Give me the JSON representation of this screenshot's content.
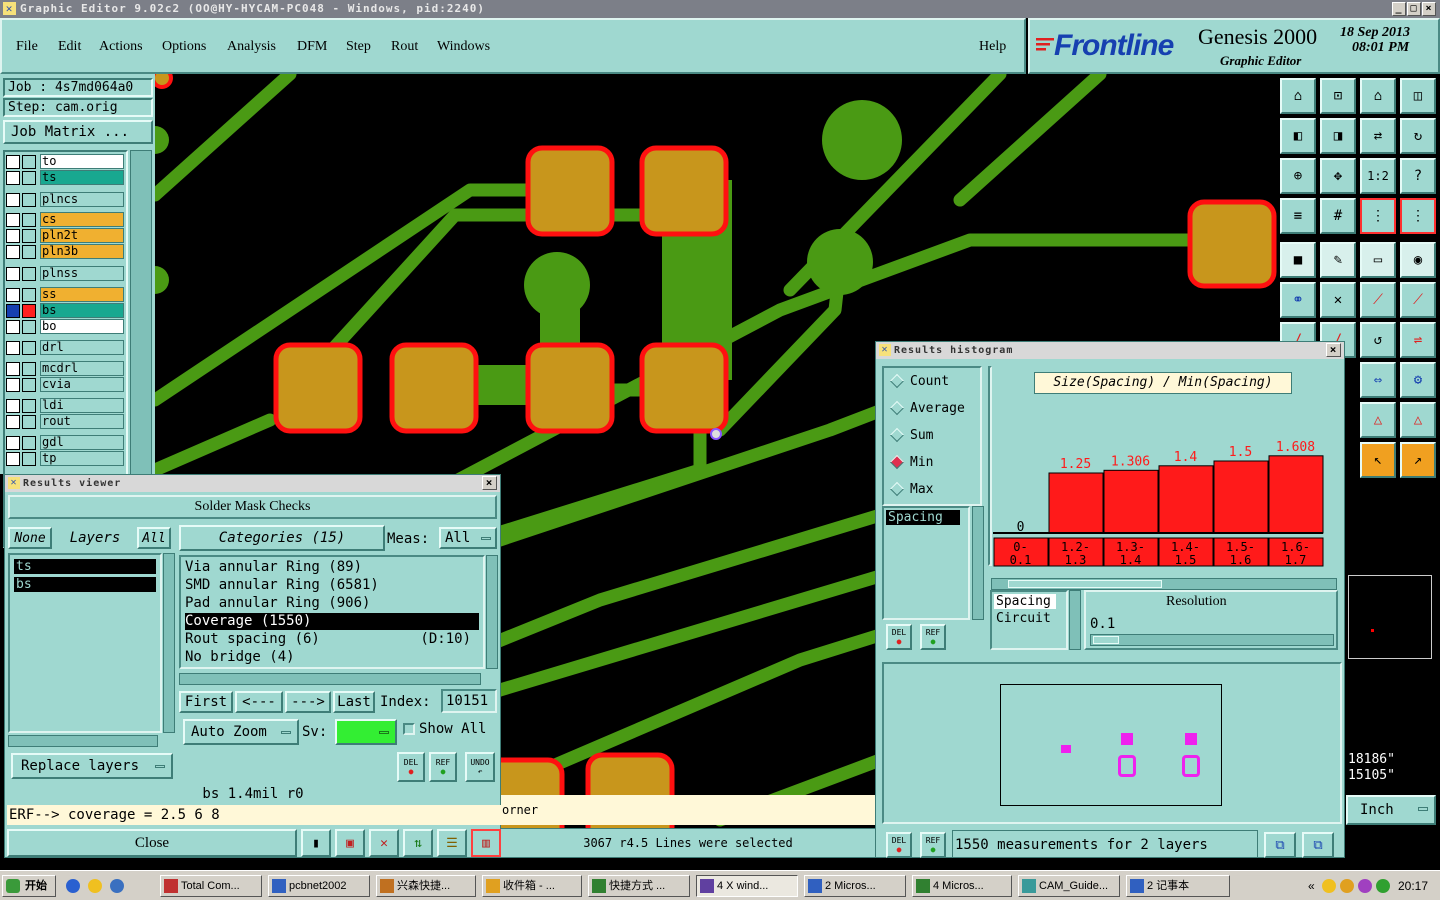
{
  "window": {
    "title": "Graphic Editor 9.02c2 (OO@HY-HYCAM-PC048 - Windows, pid:2240)"
  },
  "menu": {
    "items": [
      "File",
      "Edit",
      "Actions",
      "Options",
      "Analysis",
      "DFM",
      "Step",
      "Rout",
      "Windows"
    ],
    "help": "Help"
  },
  "brand": {
    "logo": "Frontline",
    "product": "Genesis 2000",
    "subtitle": "Graphic Editor",
    "date": "18 Sep 2013",
    "time": "08:01 PM"
  },
  "job": {
    "job_line": "Job : 4s7md064a0",
    "step_line": "Step: cam.orig",
    "matrix_button": "Job Matrix ..."
  },
  "layers": [
    {
      "name": "to",
      "color": "#ffffff"
    },
    {
      "name": "ts",
      "color": "#18a890"
    },
    {
      "name": "plncs",
      "color": "#9fd8d0"
    },
    {
      "name": "cs",
      "color": "#f0b030"
    },
    {
      "name": "pln2t",
      "color": "#f0b030"
    },
    {
      "name": "pln3b",
      "color": "#f0b030"
    },
    {
      "name": "plnss",
      "color": "#9fd8d0"
    },
    {
      "name": "ss",
      "color": "#f0b030"
    },
    {
      "name": "bs",
      "color": "#18a890"
    },
    {
      "name": "bo",
      "color": "#ffffff"
    },
    {
      "name": "drl",
      "color": "#9fd8d0"
    },
    {
      "name": "mcdrl",
      "color": "#9fd8d0"
    },
    {
      "name": "cvia",
      "color": "#9fd8d0"
    },
    {
      "name": "ldi",
      "color": "#9fd8d0"
    },
    {
      "name": "rout",
      "color": "#9fd8d0"
    },
    {
      "name": "gdl",
      "color": "#9fd8d0"
    },
    {
      "name": "tp",
      "color": "#9fd8d0"
    }
  ],
  "results_viewer": {
    "title": "Results viewer",
    "header": "Solder Mask Checks",
    "none_btn": "None",
    "layers_label": "Layers",
    "all_btn": "All",
    "layer_items": [
      "ts",
      "bs"
    ],
    "categories_label": "Categories (15)",
    "meas_label": "Meas:",
    "meas_value": "All",
    "categories": [
      {
        "label": "Via annular Ring (89)",
        "extra": ""
      },
      {
        "label": "SMD annular Ring (6581)",
        "extra": ""
      },
      {
        "label": "Pad annular Ring (906)",
        "extra": ""
      },
      {
        "label": "Coverage (1550)",
        "extra": ""
      },
      {
        "label": "Rout spacing (6)",
        "extra": "(D:10)"
      },
      {
        "label": "No bridge (4)",
        "extra": ""
      }
    ],
    "first_btn": "First",
    "prev_btn": "<---",
    "next_btn": "--->",
    "last_btn": "Last",
    "index_label": "Index:",
    "index_value": "10151",
    "auto_zoom": "Auto Zoom",
    "sv_label": "Sv:",
    "show_all": "Show All",
    "replace_layers": "Replace layers",
    "del": "DEL",
    "ref": "REF",
    "undo": "UNDO",
    "status": "bs 1.4mil   r0",
    "erf": "ERF--> coverage = 2.5 6 8",
    "close": "Close"
  },
  "histogram": {
    "title": "Results histogram",
    "stats": [
      "Count",
      "Average",
      "Sum",
      "Min",
      "Max"
    ],
    "selected_stat": "Min",
    "chart_title": "Size(Spacing) / Min(Spacing)",
    "list_items": [
      "Spacing"
    ],
    "zero_label": "0",
    "chart_data": {
      "type": "bar",
      "title": "Size(Spacing) / Min(Spacing)",
      "categories": [
        "0-0.1",
        "1.2-1.3",
        "1.3-1.4",
        "1.4-1.5",
        "1.5-1.6",
        "1.6-1.7"
      ],
      "values": [
        0,
        1.25,
        1.306,
        1.4,
        1.5,
        1.608
      ],
      "value_labels": [
        "0",
        "1.25",
        "1.306",
        "1.4",
        "1.5",
        "1.608"
      ]
    },
    "bins": [
      [
        "0-",
        "0.1"
      ],
      [
        "1.2-",
        "1.3"
      ],
      [
        "1.3-",
        "1.4"
      ],
      [
        "1.4-",
        "1.5"
      ],
      [
        "1.5-",
        "1.6"
      ],
      [
        "1.6-",
        "1.7"
      ]
    ],
    "sub_list": [
      "Spacing",
      "Circuit"
    ],
    "resolution_label": "Resolution",
    "resolution_value": "0.1",
    "measurements": "1550 measurements for 2 layers",
    "del": "DEL",
    "ref": "REF"
  },
  "status_bar": {
    "corner_text": "orner",
    "lines_selected": "3067 r4.5 Lines were selected",
    "coord1": "18186\"",
    "coord2": "15105\"",
    "units": "Inch"
  },
  "taskbar": {
    "start": "开始",
    "tasks": [
      "Total Com...",
      "pcbnet2002",
      "兴森快捷...",
      "收件箱 - ...",
      "快捷方式 ...",
      "4 X wind...",
      "2 Micros...",
      "4 Micros...",
      "CAM_Guide...",
      "2 记事本"
    ],
    "clock": "20:17"
  },
  "colors": {
    "panel": "#9fd8d0",
    "trace": "#4a9a14",
    "pad": "#c8961c",
    "pad_outline": "#ff1010",
    "bar": "#ff1a1a"
  }
}
